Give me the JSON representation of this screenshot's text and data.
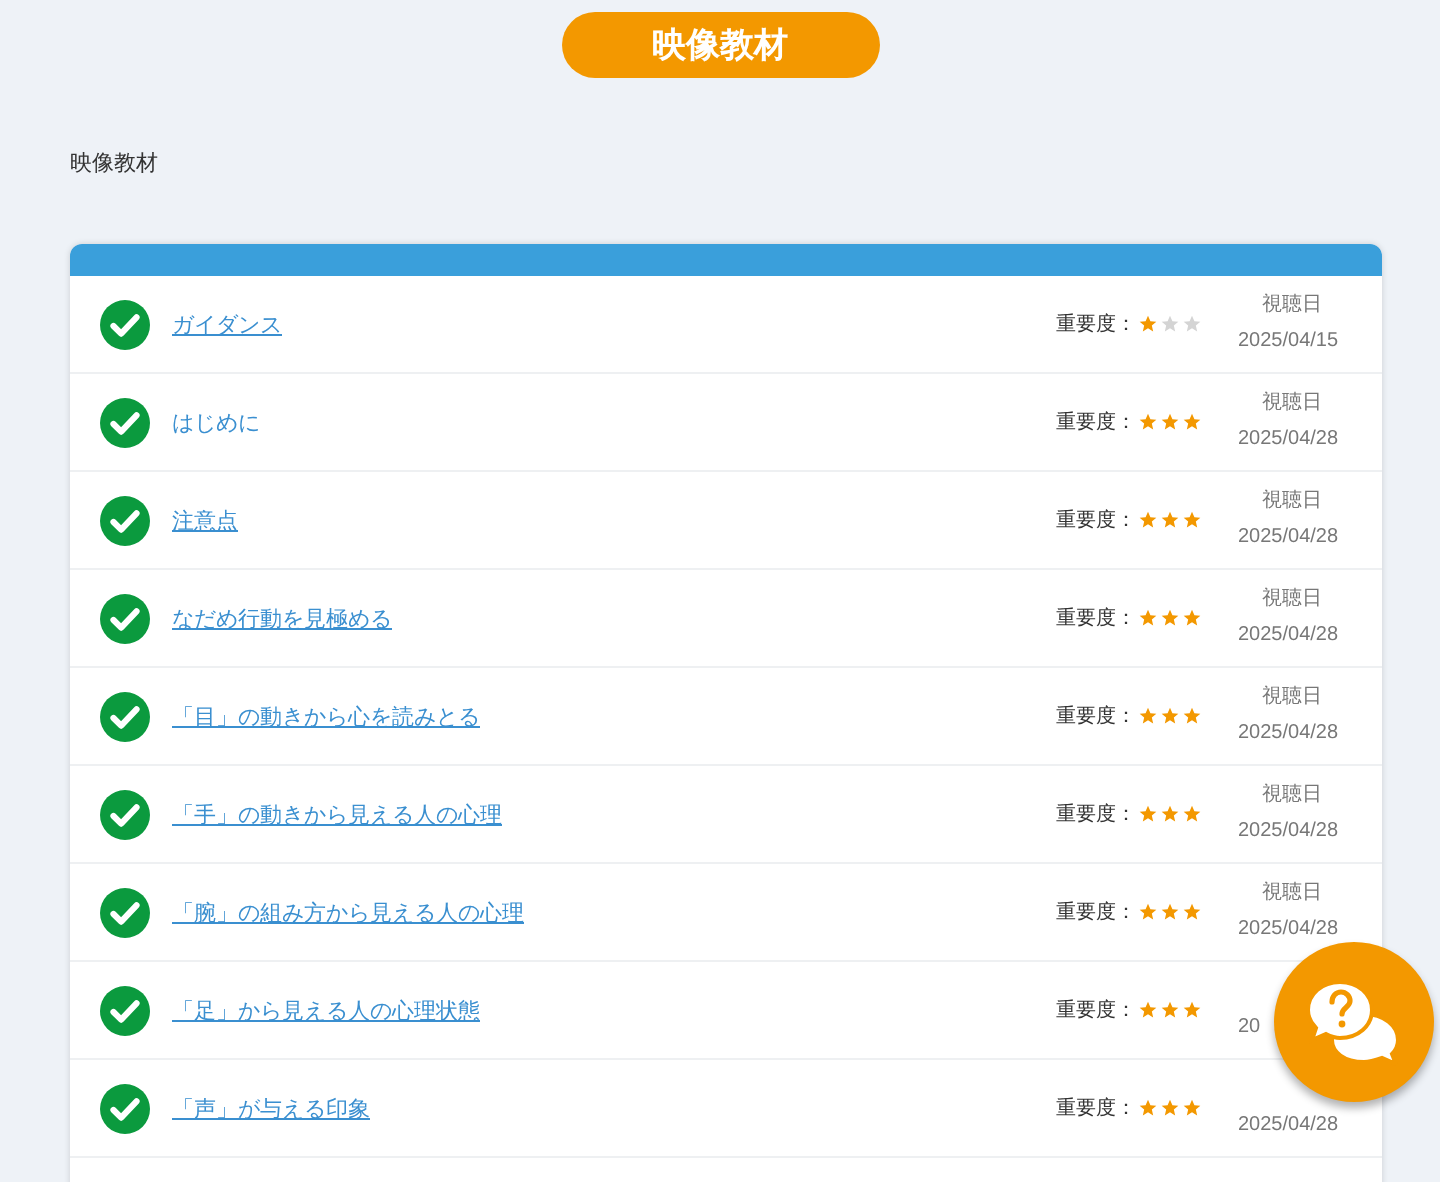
{
  "header": {
    "title": "映像教材"
  },
  "breadcrumb": "映像教材",
  "lessons": [
    {
      "title": "ガイダンス",
      "linked": true,
      "done": true,
      "importance_label": "重要度：",
      "stars": 1,
      "date_label": "視聴日",
      "date": "2025/04/15"
    },
    {
      "title": "はじめに",
      "linked": false,
      "done": true,
      "importance_label": "重要度：",
      "stars": 3,
      "date_label": "視聴日",
      "date": "2025/04/28"
    },
    {
      "title": "注意点",
      "linked": true,
      "done": true,
      "importance_label": "重要度：",
      "stars": 3,
      "date_label": "視聴日",
      "date": "2025/04/28"
    },
    {
      "title": "なだめ行動を見極める",
      "linked": true,
      "done": true,
      "importance_label": "重要度：",
      "stars": 3,
      "date_label": "視聴日",
      "date": "2025/04/28"
    },
    {
      "title": "「目」の動きから心を読みとる",
      "linked": true,
      "done": true,
      "importance_label": "重要度：",
      "stars": 3,
      "date_label": "視聴日",
      "date": "2025/04/28"
    },
    {
      "title": "「手」の動きから見える人の心理",
      "linked": true,
      "done": true,
      "importance_label": "重要度：",
      "stars": 3,
      "date_label": "視聴日",
      "date": "2025/04/28"
    },
    {
      "title": "「腕」の組み方から見える人の心理",
      "linked": true,
      "done": true,
      "importance_label": "重要度：",
      "stars": 3,
      "date_label": "視聴日",
      "date": "2025/04/28"
    },
    {
      "title": "「足」から見える人の心理状態",
      "linked": true,
      "done": true,
      "importance_label": "重要度：",
      "stars": 3,
      "date": "20"
    },
    {
      "title": "「声」が与える印象",
      "linked": true,
      "done": true,
      "importance_label": "重要度：",
      "stars": 3,
      "date": "2025/04/28"
    }
  ]
}
